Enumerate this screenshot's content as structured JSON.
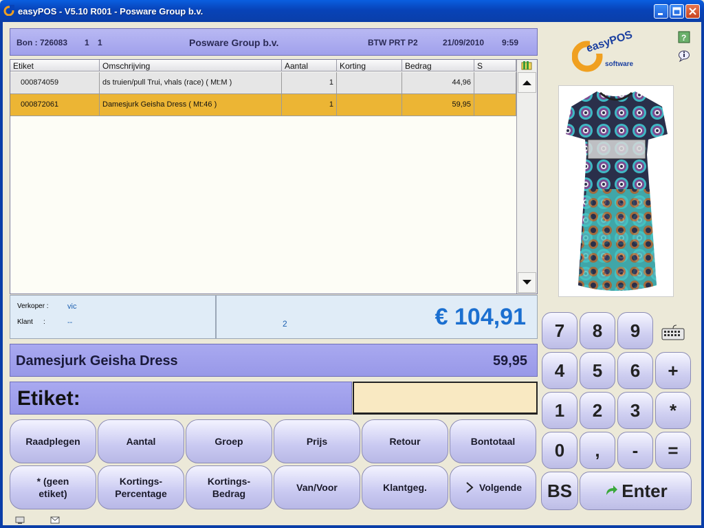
{
  "window": {
    "title": "easyPOS - V5.10 R001 - Posware Group b.v.",
    "icon": "easypos-icon",
    "buttons": [
      "minimize-icon",
      "maximize-icon",
      "close-icon"
    ]
  },
  "header": {
    "bon_label": "Bon : 726083",
    "val1": "1",
    "val2": "1",
    "company": "Posware Group b.v.",
    "btw": "BTW PRT P2",
    "date": "21/09/2010",
    "time": "9:59"
  },
  "grid": {
    "columns": [
      "Etiket",
      "Omschrijving",
      "Aantal",
      "Korting",
      "Bedrag",
      "S"
    ],
    "rows": [
      {
        "etiket": "000874059",
        "omschrijving": "ds truien/pull Trui, vhals (race)  ( Mt:M )",
        "aantal": "1",
        "korting": "",
        "bedrag": "44,96",
        "s": ""
      },
      {
        "etiket": "000872061",
        "omschrijving": "Damesjurk Geisha Dress  ( Mt:46 )",
        "aantal": "1",
        "korting": "",
        "bedrag": "59,95",
        "s": ""
      }
    ]
  },
  "info": {
    "verkoper_label": "Verkoper :",
    "verkoper_value": "vic",
    "klant_label": "Klant",
    "klant_colon": ":",
    "klant_value": "--",
    "item_count": "2",
    "total": "€ 104,91"
  },
  "current_item": {
    "name": "Damesjurk Geisha Dress",
    "price": "59,95"
  },
  "etiket": {
    "label": "Etiket:",
    "value": ""
  },
  "function_buttons": [
    "Raadplegen",
    "Aantal",
    "Groep",
    "Prijs",
    "Retour",
    "Bontotaal",
    "* (geen\netiket)",
    "Kortings-\nPercentage",
    "Kortings-\nBedrag",
    "Van/Voor",
    "Klantgeg.",
    "Volgende"
  ],
  "keypad": {
    "keys": [
      "7",
      "8",
      "9",
      "4",
      "5",
      "6",
      "+",
      "1",
      "2",
      "3",
      "*",
      "0",
      ",",
      "-",
      "="
    ],
    "bs": "BS",
    "enter": "Enter"
  },
  "logo": {
    "line1": "easyPOS",
    "line2": "software"
  },
  "colors": {
    "accent": "#a0a0ec",
    "selected_row": "#ecb534",
    "total_text": "#1b6fd0"
  }
}
